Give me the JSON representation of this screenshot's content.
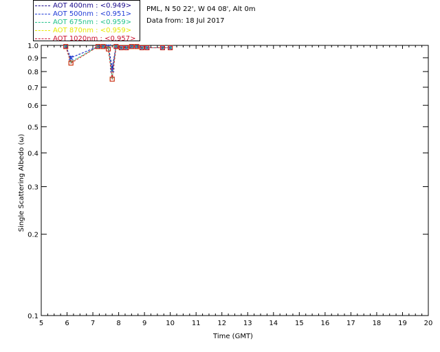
{
  "info": {
    "location": "PML, N 50 22', W 04 08', Alt 0m",
    "date": "Data from: 18 Jul 2017"
  },
  "legend": [
    {
      "label": "AOT  400nm : <0.949>",
      "color": "#1a0a8c"
    },
    {
      "label": "AOT  500nm : <0.951>",
      "color": "#1f3ad6"
    },
    {
      "label": "AOT  675nm : <0.959>",
      "color": "#21c28a"
    },
    {
      "label": "AOT  870nm : <0.959>",
      "color": "#e8e800"
    },
    {
      "label": "AOT 1020nm : <0.957>",
      "color": "#c8102e"
    }
  ],
  "chart_data": {
    "type": "scatter",
    "xlabel": "Time (GMT)",
    "ylabel": "Single Scattering Albedo (ω)",
    "xlim": [
      5,
      20
    ],
    "ylim": [
      0.1,
      1.0
    ],
    "yscale": "log",
    "xticks": [
      5,
      6,
      7,
      8,
      9,
      10,
      11,
      12,
      13,
      14,
      15,
      16,
      17,
      18,
      19,
      20
    ],
    "yticks": [
      0.1,
      0.2,
      0.3,
      0.4,
      0.5,
      0.6,
      0.7,
      0.8,
      0.9,
      1.0
    ],
    "ytick_labels": [
      "0.1",
      "0.2",
      "0.3",
      "0.4",
      "0.5",
      "0.6",
      "0.7",
      "0.8",
      "0.9",
      "1.0"
    ],
    "series": [
      {
        "name": "AOT  400nm : <0.949>",
        "color": "#1a0a8c",
        "x": [
          5.95,
          6.15,
          7.2,
          7.4,
          7.6,
          7.75,
          7.9,
          8.1,
          8.3,
          8.5,
          8.7,
          8.9,
          9.1,
          9.7,
          10.0
        ],
        "y": [
          0.99,
          0.9,
          0.99,
          0.99,
          0.99,
          0.83,
          0.99,
          0.98,
          0.98,
          0.99,
          0.99,
          0.98,
          0.98,
          0.98,
          0.98
        ]
      },
      {
        "name": "AOT  500nm : <0.951>",
        "color": "#1f3ad6",
        "x": [
          5.95,
          6.15,
          7.2,
          7.4,
          7.6,
          7.75,
          7.9,
          8.1,
          8.3,
          8.5,
          8.7,
          8.9,
          9.1,
          9.7,
          10.0
        ],
        "y": [
          0.99,
          0.9,
          0.99,
          0.99,
          0.99,
          0.81,
          0.99,
          0.98,
          0.98,
          0.99,
          0.99,
          0.98,
          0.98,
          0.98,
          0.98
        ]
      },
      {
        "name": "AOT  675nm : <0.959>",
        "color": "#21c28a",
        "x": [
          5.95,
          6.15,
          7.2,
          7.4,
          7.6,
          7.75,
          7.9,
          8.1,
          8.3,
          8.5,
          8.7,
          8.9,
          9.1,
          9.7,
          10.0
        ],
        "y": [
          0.99,
          0.87,
          0.99,
          0.99,
          0.98,
          0.76,
          0.99,
          0.98,
          0.98,
          0.99,
          0.99,
          0.98,
          0.98,
          0.98,
          0.98
        ]
      },
      {
        "name": "AOT  870nm : <0.959>",
        "color": "#e8e800",
        "x": [
          5.95,
          6.15,
          7.2,
          7.4,
          7.6,
          7.75,
          7.9,
          8.1,
          8.3,
          8.5,
          8.7,
          8.9,
          9.1,
          9.7,
          10.0
        ],
        "y": [
          0.99,
          0.86,
          0.99,
          0.99,
          0.97,
          0.75,
          0.99,
          0.98,
          0.98,
          0.99,
          0.99,
          0.98,
          0.98,
          0.98,
          0.98
        ]
      },
      {
        "name": "AOT 1020nm : <0.957>",
        "color": "#c8102e",
        "x": [
          5.95,
          6.15,
          7.2,
          7.4,
          7.6,
          7.75,
          7.9,
          8.1,
          8.3,
          8.5,
          8.7,
          8.9,
          9.1,
          9.7,
          10.0
        ],
        "y": [
          0.99,
          0.86,
          0.99,
          0.99,
          0.97,
          0.75,
          0.99,
          0.98,
          0.98,
          0.99,
          0.99,
          0.98,
          0.98,
          0.98,
          0.98
        ]
      }
    ]
  }
}
